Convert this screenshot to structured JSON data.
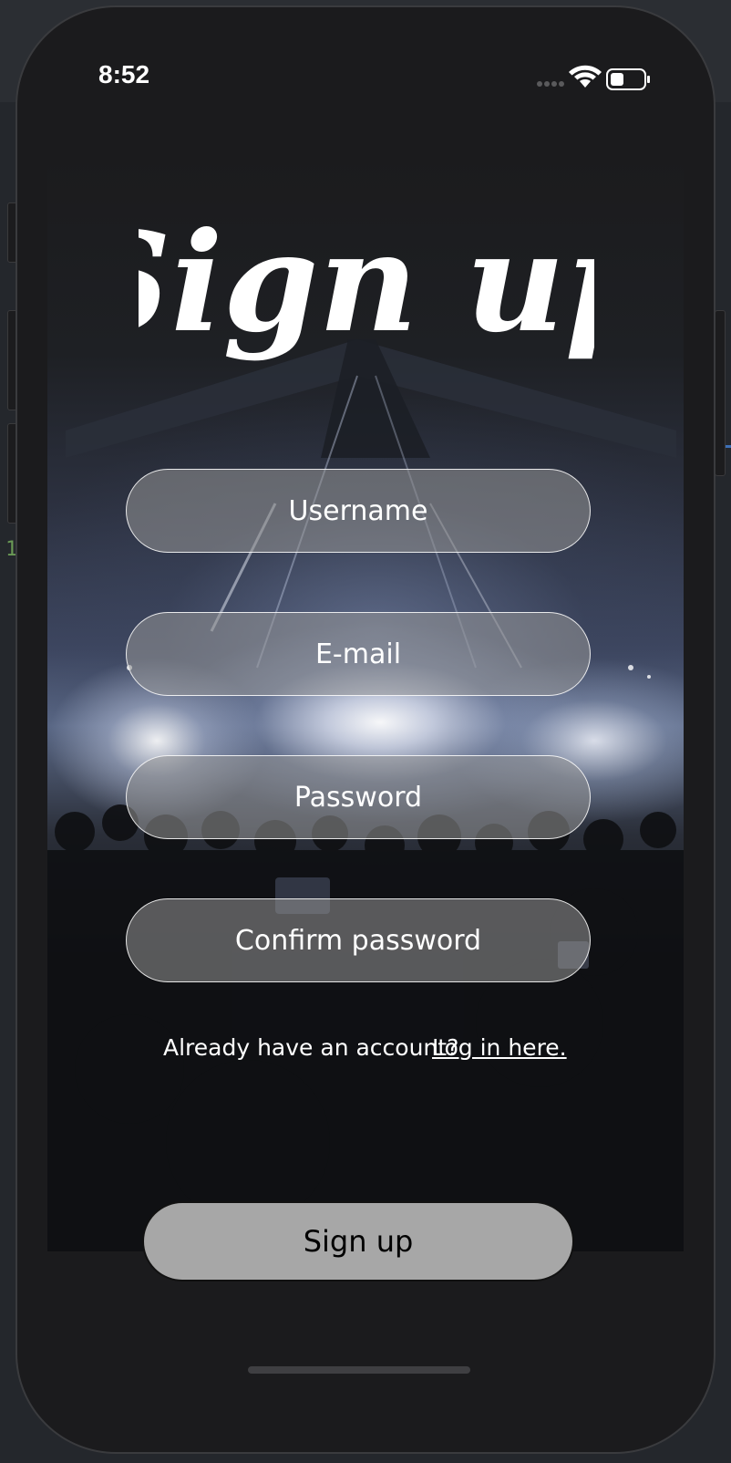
{
  "status_bar": {
    "time": "8:52"
  },
  "title": "Sign up",
  "form": {
    "username_placeholder": "Username",
    "email_placeholder": "E-mail",
    "password_placeholder": "Password",
    "confirm_password_placeholder": "Confirm password"
  },
  "account_prompt": {
    "text": "Already have an account?",
    "link": "Log in here."
  },
  "signup_button": "Sign up",
  "colors": {
    "field_fill": "#969696",
    "button_fill": "#a7a7a7",
    "text": "#ffffff"
  }
}
